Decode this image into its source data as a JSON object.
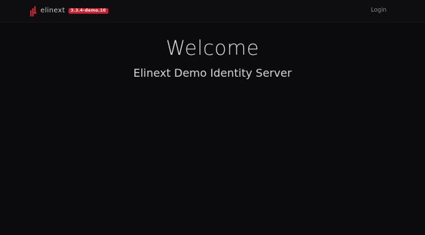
{
  "navbar": {
    "logo_text": "elinext",
    "logo_icon": "elinext-logo-icon",
    "version": "3.3.4-demo.10",
    "login_label": "Login"
  },
  "main": {
    "title": "Welcome",
    "subtitle": "Elinext Demo Identity Server"
  },
  "colors": {
    "background": "#0b0b0d",
    "accent": "#d11f2e",
    "text": "#d9d9d9",
    "nav_link": "#8a8a8a"
  }
}
